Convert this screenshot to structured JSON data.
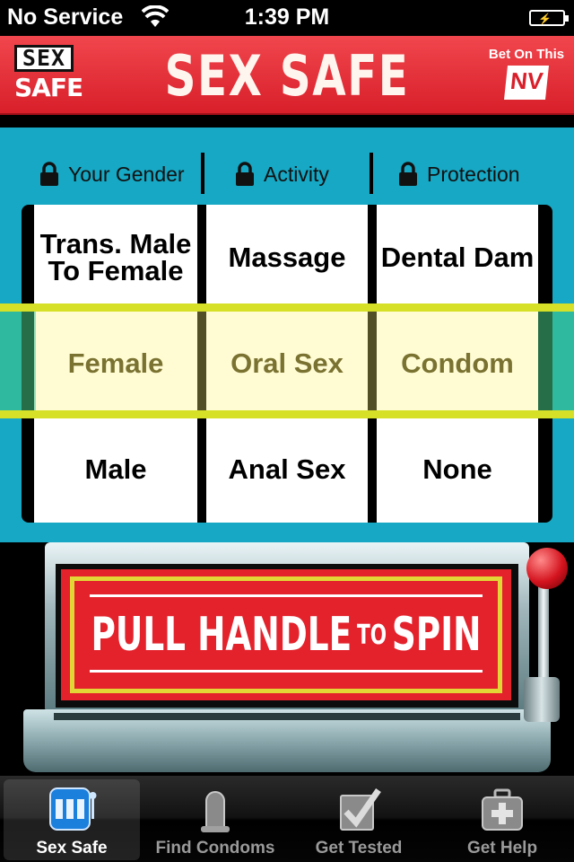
{
  "status_bar": {
    "carrier": "No Service",
    "time": "1:39 PM"
  },
  "header": {
    "logo_top": "SEX",
    "logo_bottom": "SAFE",
    "title": "SEX SAFE",
    "bet_label": "Bet On This",
    "bet_badge": "NV",
    "colors": {
      "brand_red": "#e22a33",
      "accent_yellow": "#d6e026",
      "teal": "#16a8c4"
    }
  },
  "columns": [
    {
      "header": "Your Gender",
      "locked": true,
      "top": "Trans. Male To Female",
      "selected": "Female",
      "bottom": "Male"
    },
    {
      "header": "Activity",
      "locked": true,
      "top": "Massage",
      "selected": "Oral Sex",
      "bottom": "Anal Sex"
    },
    {
      "header": "Protection",
      "locked": true,
      "top": "Dental Dam",
      "selected": "Condom",
      "bottom": "None"
    }
  ],
  "machine": {
    "sign_part1": "PULL HANDLE",
    "sign_part2": "TO",
    "sign_part3": "SPIN"
  },
  "tabs": [
    {
      "label": "Sex Safe",
      "icon": "slot-machine-icon",
      "active": true
    },
    {
      "label": "Find Condoms",
      "icon": "condom-icon",
      "active": false
    },
    {
      "label": "Get Tested",
      "icon": "checkmark-icon",
      "active": false
    },
    {
      "label": "Get Help",
      "icon": "first-aid-icon",
      "active": false
    }
  ]
}
